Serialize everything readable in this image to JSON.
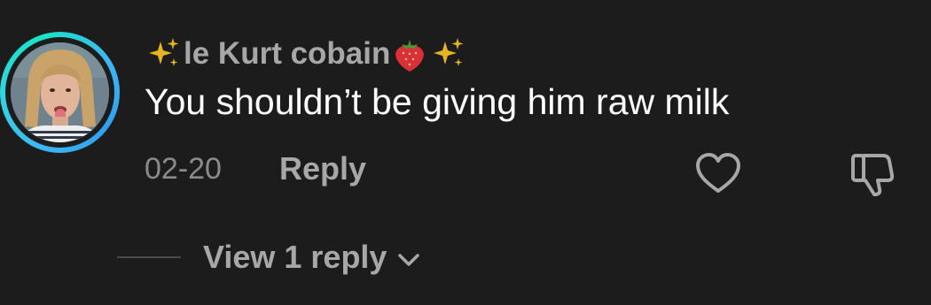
{
  "comment": {
    "avatar_icon": "user-avatar-photo",
    "avatar_ring_color": "#2fd7e0",
    "username": {
      "prefix_icon": "sparkles-icon",
      "name": "le Kurt cobain",
      "suffix_icons": [
        "strawberry-icon",
        "sparkles-icon"
      ]
    },
    "text": "You shouldn’t be giving him raw milk",
    "date": "02-20",
    "reply_label": "Reply",
    "like_icon": "heart-outline-icon",
    "dislike_icon": "thumbs-down-outline-icon"
  },
  "replies": {
    "view_label": "View 1 reply",
    "expand_icon": "chevron-down-icon"
  },
  "colors": {
    "background": "#1c1c1c",
    "primary_text": "#ffffff",
    "secondary_text": "#a7a7a7",
    "muted_text": "#8b8b8b"
  }
}
